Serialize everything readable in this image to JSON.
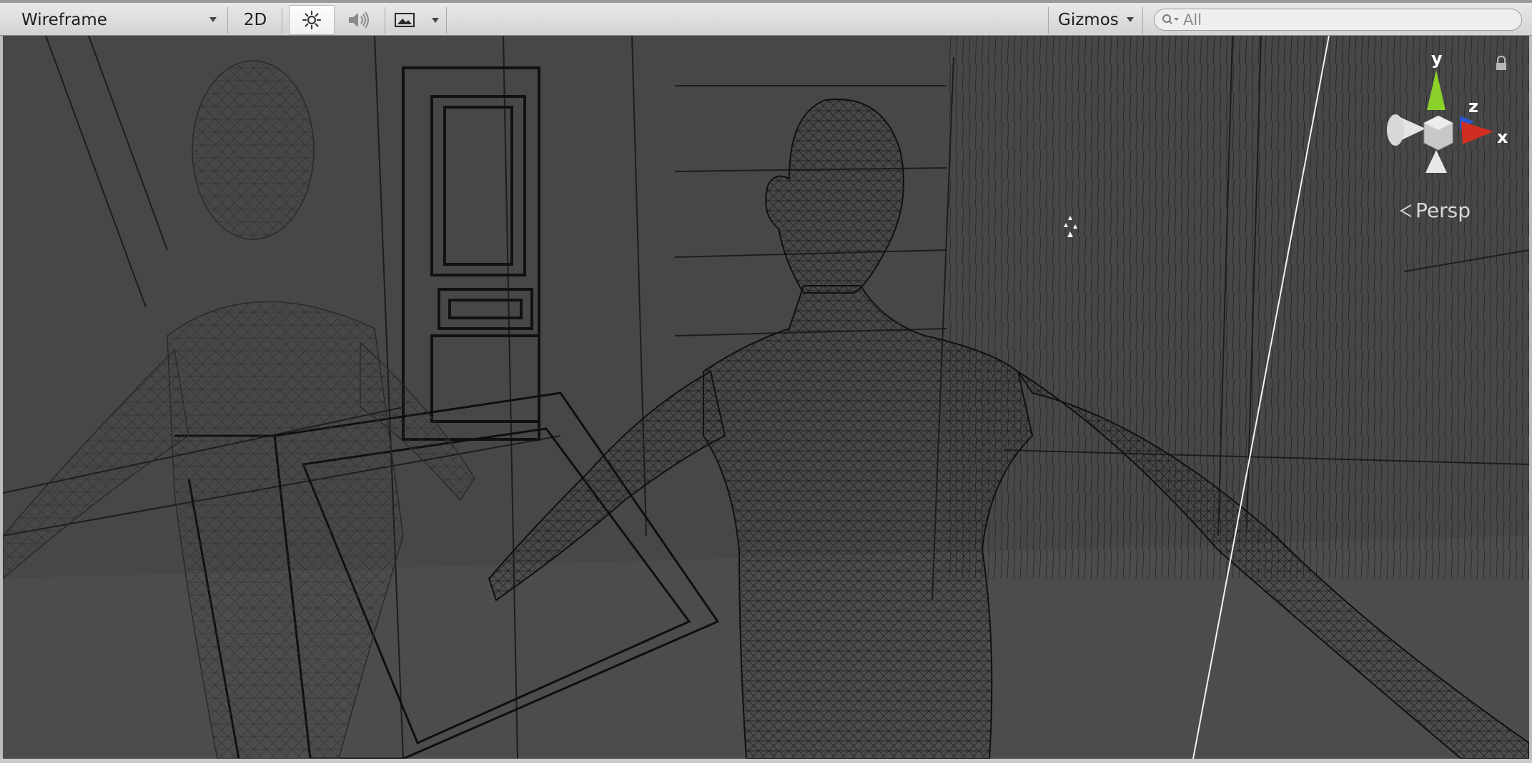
{
  "toolbar": {
    "draw_mode": "Wireframe",
    "mode_2d": "2D",
    "lighting_icon": "sun-icon",
    "audio_icon": "speaker-icon",
    "effects_icon": "image-icon",
    "gizmos_label": "Gizmos",
    "search": {
      "value": "",
      "placeholder": "All"
    }
  },
  "viewport": {
    "projection_label": "Persp",
    "axes": {
      "y": "y",
      "z": "z",
      "x": "x"
    },
    "axis_colors": {
      "x": "#d12e22",
      "y": "#8bd12a",
      "z": "#2a56c9"
    },
    "background_color": "#474747"
  }
}
